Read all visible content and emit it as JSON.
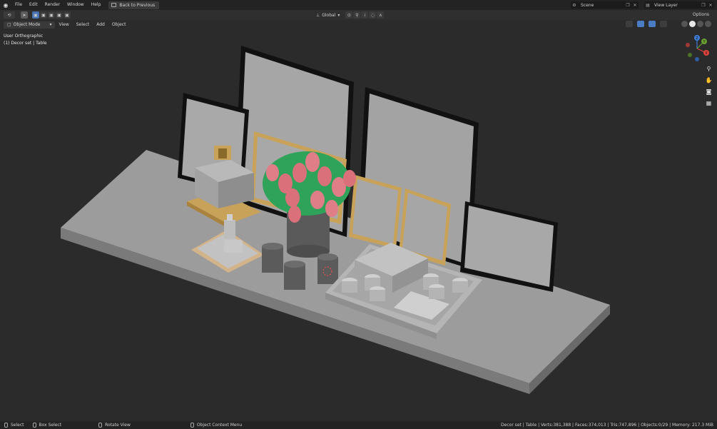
{
  "topbar": {
    "menus": [
      "File",
      "Edit",
      "Render",
      "Window",
      "Help"
    ],
    "back_label": "Back to Previous",
    "scene": "Scene",
    "view_layer": "View Layer"
  },
  "toolbar": {
    "orientation": "Global",
    "options_label": "Options"
  },
  "viewport": {
    "mode": "Object Mode",
    "menus": [
      "View",
      "Select",
      "Add",
      "Object"
    ],
    "view_name": "User Orthographic",
    "active_object": "(1) Decor set | Table"
  },
  "gizmo": {
    "x_color": "#e0433c",
    "y_color": "#6aa02f",
    "z_color": "#3d7ed8",
    "labels": [
      "X",
      "Y",
      "Z"
    ]
  },
  "statusbar": {
    "select": "Select",
    "box_select": "Box Select",
    "rotate_view": "Rotate View",
    "context_menu": "Object Context Menu",
    "stats": "Decor set | Table | Verts:381,388 | Faces:374,013 | Tris:747,896 | Objects:0/29 | Memory: 217.3 MiB"
  },
  "colors": {
    "viewport_bg": "#2b2b2b",
    "accent": "#4772b3",
    "gold_frame": "#c9a25a",
    "tulip": "#d9707a",
    "leaf": "#2fa35a"
  }
}
